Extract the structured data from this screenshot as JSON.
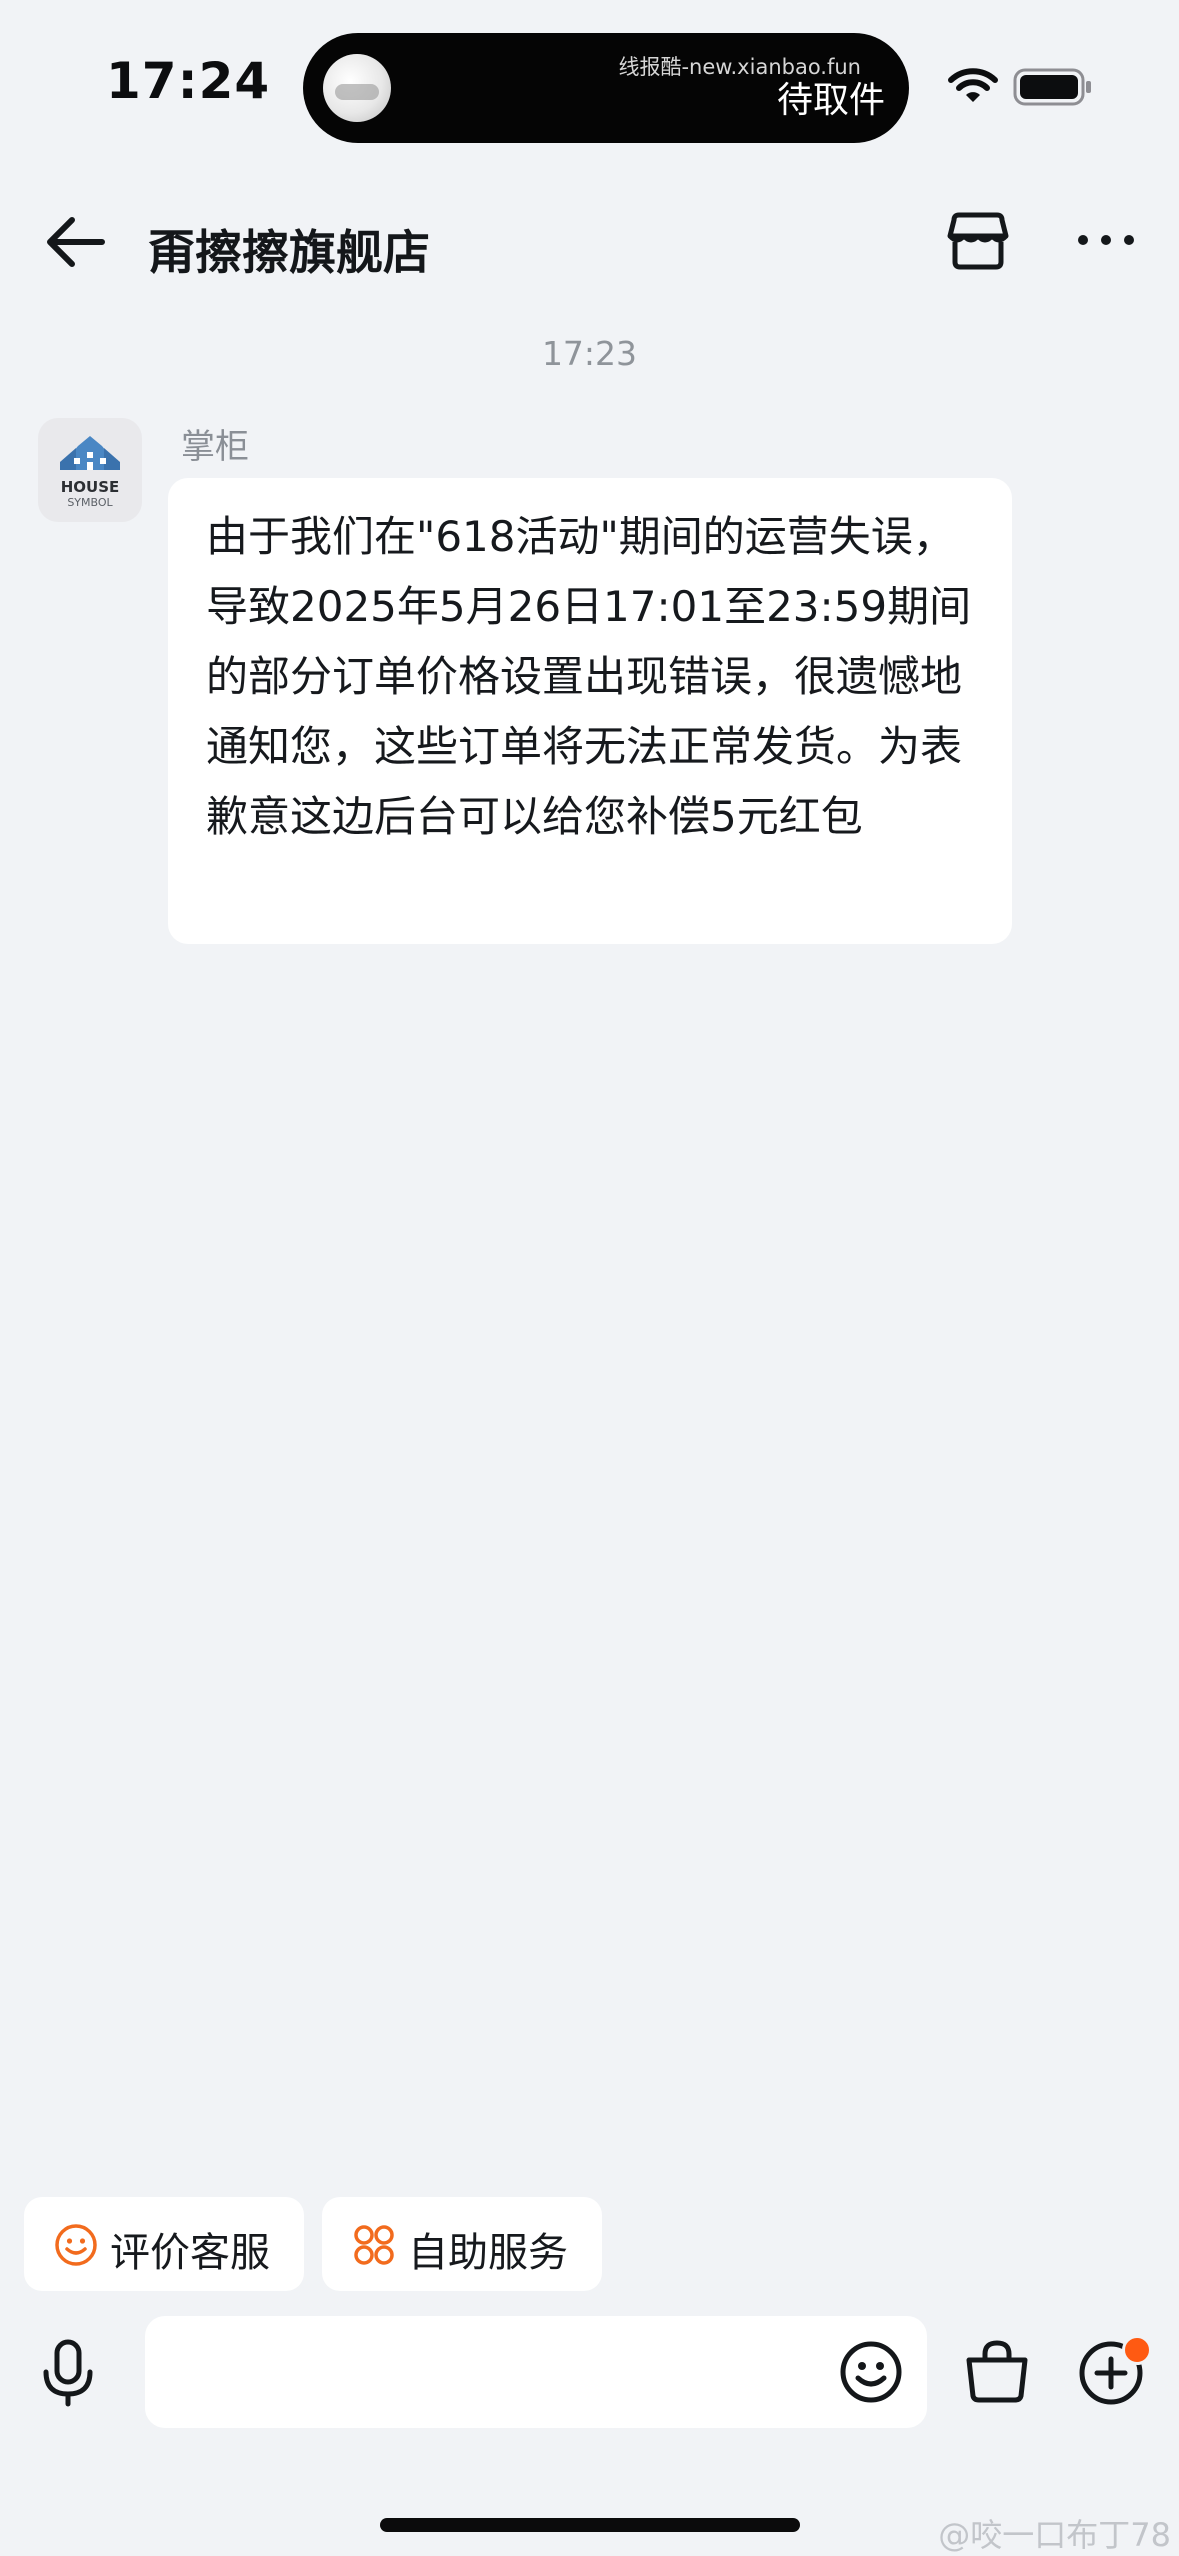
{
  "status_bar": {
    "time": "17:24",
    "island_watermark": "线报酷-new.xianbao.fun",
    "island_label": "待取件",
    "icons": [
      "wifi-icon",
      "battery-icon"
    ]
  },
  "header": {
    "title": "甭擦擦旗舰店",
    "icons": [
      "back-arrow-icon",
      "store-icon",
      "more-icon"
    ]
  },
  "chat": {
    "timestamp": "17:23",
    "messages": [
      {
        "sender": "掌柜",
        "avatar_line1": "HOUSE",
        "avatar_line2": "SYMBOL",
        "text": "由于我们在\"618活动\"期间的运营失误，导致2025年5月26日17:01至23:59期间的部分订单价格设置出现错误，很遗憾地通知您，这些订单将无法正常发货。为表歉意这边后台可以给您补偿5元红包"
      }
    ]
  },
  "quick_actions": [
    {
      "label": "评价客服",
      "icon": "smile-icon",
      "color": "#f26b1d"
    },
    {
      "label": "自助服务",
      "icon": "service-grid-icon",
      "color": "#f26b1d"
    }
  ],
  "input_bar": {
    "value": "",
    "placeholder": "",
    "icons": [
      "microphone-icon",
      "emoji-icon",
      "shopping-bag-icon",
      "plus-icon"
    ],
    "notify_color": "#ff5a12"
  },
  "watermark": "@咬一口布丁78",
  "colors": {
    "background": "#f1f3f6",
    "bubble": "#ffffff",
    "accent": "#f26b1d"
  }
}
